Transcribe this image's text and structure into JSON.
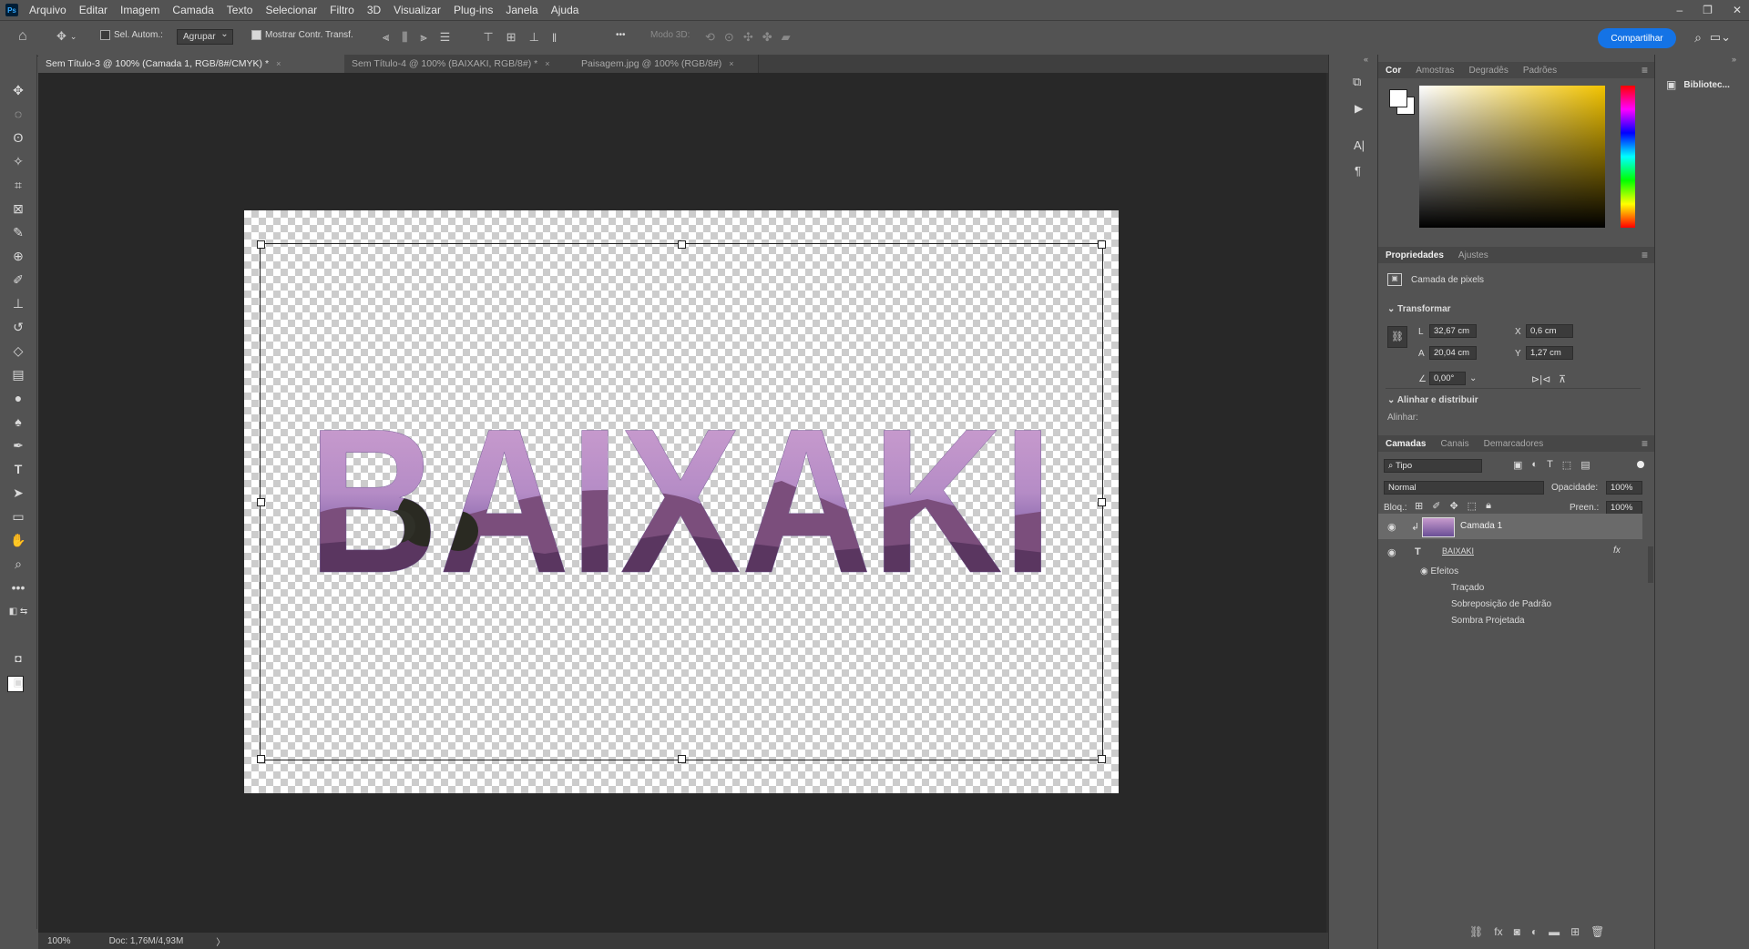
{
  "app": {
    "logo": "Ps"
  },
  "menu": [
    "Arquivo",
    "Editar",
    "Imagem",
    "Camada",
    "Texto",
    "Selecionar",
    "Filtro",
    "3D",
    "Visualizar",
    "Plug-ins",
    "Janela",
    "Ajuda"
  ],
  "window_controls": {
    "minimize": "–",
    "restore": "❐",
    "close": "✕"
  },
  "options": {
    "auto_select_label": "Sel. Autom.:",
    "group_value": "Agrupar",
    "show_transform_label": "Mostrar Contr. Transf.",
    "mode_3d_label": "Modo 3D:",
    "more": "•••",
    "share_label": "Compartilhar"
  },
  "tabs": [
    {
      "label": "Sem Título-3 @ 100% (Camada 1, RGB/8#/CMYK) *",
      "active": true
    },
    {
      "label": "Sem Título-4 @ 100% (BAIXAKI, RGB/8#) *",
      "active": false
    },
    {
      "label": "Paisagem.jpg @ 100% (RGB/8#)",
      "active": false
    }
  ],
  "tab_close": "×",
  "canvas": {
    "text": "BAIXAKI"
  },
  "status": {
    "zoom": "100%",
    "doc": "Doc: 1,76M/4,93M",
    "arrow": "〉"
  },
  "color_panel": {
    "tabs": [
      "Cor",
      "Amostras",
      "Degradês",
      "Padrões"
    ],
    "foreground": "#ffffff",
    "background": "#ffffff",
    "hue": "#f2c300"
  },
  "properties": {
    "tabs": [
      "Propriedades",
      "Ajustes"
    ],
    "layer_type": "Camada de pixels",
    "transform_title": "Transformar",
    "w_label": "L",
    "w_value": "32,67 cm",
    "h_label": "A",
    "h_value": "20,04 cm",
    "x_label": "X",
    "x_value": "0,6 cm",
    "y_label": "Y",
    "y_value": "1,27 cm",
    "angle_value": "0,00°",
    "align_title": "Alinhar e distribuir",
    "align_label": "Alinhar:"
  },
  "layers": {
    "tabs": [
      "Camadas",
      "Canais",
      "Demarcadores"
    ],
    "filter_value": "Tipo",
    "blend_mode": "Normal",
    "opacity_label": "Opacidade:",
    "opacity_value": "100%",
    "lock_label": "Bloq.:",
    "fill_label": "Preen.:",
    "fill_value": "100%",
    "items": [
      {
        "name": "Camada 1",
        "type": "pixel",
        "selected": true
      },
      {
        "name": "BAIXAKI",
        "type": "text",
        "selected": false
      }
    ],
    "fx_label": "fx",
    "effects_label": "Efeitos",
    "effects": [
      "Traçado",
      "Sobreposição de Padrão",
      "Sombra Projetada"
    ]
  },
  "libraries": {
    "label": "Bibliotec..."
  }
}
